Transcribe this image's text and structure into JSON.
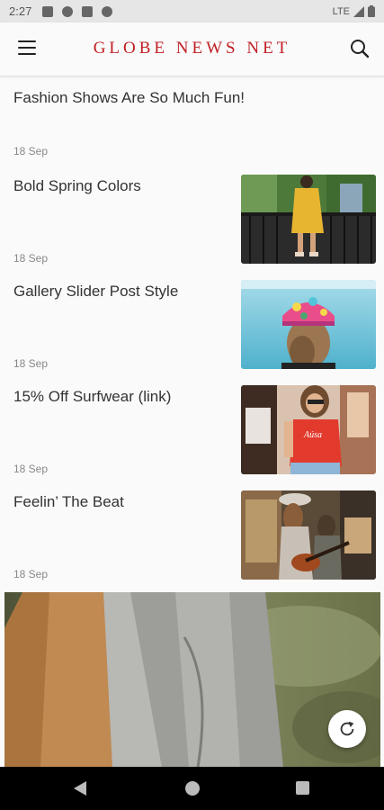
{
  "status_bar": {
    "time": "2:27",
    "network": "LTE",
    "icons": [
      "a-icon",
      "cast-icon",
      "sd-card-icon",
      "data-saver-icon",
      "wifi-icon",
      "signal-icon",
      "battery-icon"
    ]
  },
  "header": {
    "brand": "GLOBE NEWS NET",
    "brand_color": "#c01f24",
    "icons": [
      "menu-icon",
      "search-icon"
    ]
  },
  "lead": {
    "title": "Fashion Shows Are So Much Fun!",
    "date": "18 Sep"
  },
  "articles": [
    {
      "title": "Bold Spring Colors",
      "date": "18 Sep",
      "thumb": "yellow-dress-photo"
    },
    {
      "title": "Gallery Slider Post Style",
      "date": "18 Sep",
      "thumb": "floral-cap-photo"
    },
    {
      "title": "15% Off Surfwear (link)",
      "date": "18 Sep",
      "thumb": "red-tshirt-photo"
    },
    {
      "title": "Feelin’ The Beat",
      "date": "18 Sep",
      "thumb": "guitar-street-photo"
    }
  ],
  "hero": {
    "image": "grey-scarf-photo"
  },
  "fab": {
    "icon": "refresh-icon"
  },
  "nav_bar": {
    "icons": [
      "back-icon",
      "home-icon",
      "recents-icon"
    ]
  }
}
